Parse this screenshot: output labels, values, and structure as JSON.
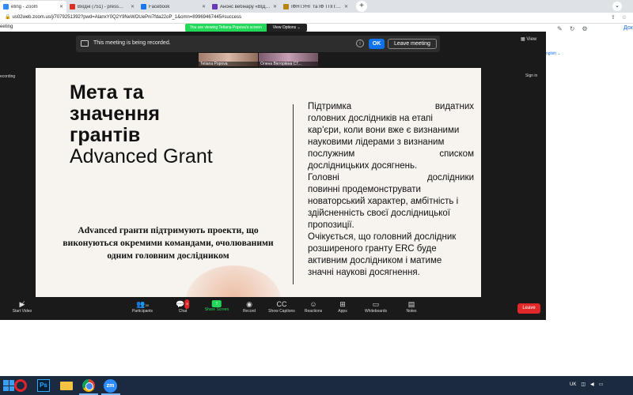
{
  "browser": {
    "tabs": [
      {
        "title": "eting - Zoom",
        "favicon_color": "#2d8cff",
        "active": true
      },
      {
        "title": "Вхідні (751) - press@nung.edu.u",
        "favicon_color": "#d93025",
        "active": false
      },
      {
        "title": "Facebook",
        "favicon_color": "#1877f2",
        "active": false
      },
      {
        "title": "Анонс вебінару «ВІДКРИТІ ХО",
        "favicon_color": "#673ab7",
        "active": false
      },
      {
        "title": "ІФНТУНГ та ІФ ТПП: спільні орг",
        "favicon_color": "#b8860b",
        "active": false
      }
    ],
    "new_tab": "+",
    "url": "us02web.zoom.us/j/7079251392?pwd=AlanxY0Q2Y9NeWOUePni7fda22oP_1&omn=89969467445#success"
  },
  "background_page": {
    "link": "Док",
    "lang_link": "nglish"
  },
  "zoom": {
    "window_title": "eeting",
    "viewing_text": "You are viewing Tetiana Popova's screen",
    "view_options": "View Options",
    "recording_notice": "This meeting is being recorded.",
    "ok_label": "OK",
    "leave_meeting_label": "Leave meeting",
    "view_label": "View",
    "recording_label": "ecording",
    "signin_label": "Sign in",
    "participants_thumbs": [
      {
        "name": "Tetiana Popova"
      },
      {
        "name": "Олена Вікторівна СТ..."
      }
    ],
    "toolbar": {
      "items": [
        {
          "label": "Start Video",
          "icon": "video-off-icon"
        },
        {
          "label": "Participants",
          "icon": "participants-icon",
          "count": "39"
        },
        {
          "label": "Chat",
          "icon": "chat-icon",
          "badge": "5"
        },
        {
          "label": "Share Screen",
          "icon": "share-screen-icon"
        },
        {
          "label": "Record",
          "icon": "record-icon"
        },
        {
          "label": "Show Captions",
          "icon": "captions-icon"
        },
        {
          "label": "Reactions",
          "icon": "reactions-icon"
        },
        {
          "label": "Apps",
          "icon": "apps-icon"
        },
        {
          "label": "Whiteboards",
          "icon": "whiteboard-icon"
        },
        {
          "label": "Notes",
          "icon": "notes-icon"
        }
      ],
      "leave_label": "Leave",
      "share_color": "#23d959",
      "leave_color": "#e02828"
    }
  },
  "slide": {
    "title_lines": [
      "Мета та",
      "значення",
      "грантів",
      "Advanced Grant"
    ],
    "subtitle_lines": [
      "Advanced гранти підтримують проекти, що",
      "виконуються окремими командами, очолюваними",
      "одним головним дослідником"
    ],
    "body_lines": [
      [
        "Підтримка",
        "видатних"
      ],
      [
        "головних дослідників на етапі"
      ],
      [
        "кар'єри, коли вони вже є визнаними"
      ],
      [
        "науковими лідерами з визнаним"
      ],
      [
        "послужним",
        "списком"
      ],
      [
        "дослідницьких досягнень."
      ],
      [
        "Головні",
        "дослідники"
      ],
      [
        "повинні продемонструвати"
      ],
      [
        "новаторський характер, амбітність і"
      ],
      [
        "здійсненність своєї дослідницької"
      ],
      [
        "пропозиції."
      ],
      [
        "Очікується, що головний дослідник"
      ],
      [
        "розширеного гранту ERC буде"
      ],
      [
        "активним дослідником і матиме"
      ],
      [
        "значні наукові досягнення."
      ]
    ]
  },
  "taskbar": {
    "tray": {
      "lang": "UK"
    }
  }
}
